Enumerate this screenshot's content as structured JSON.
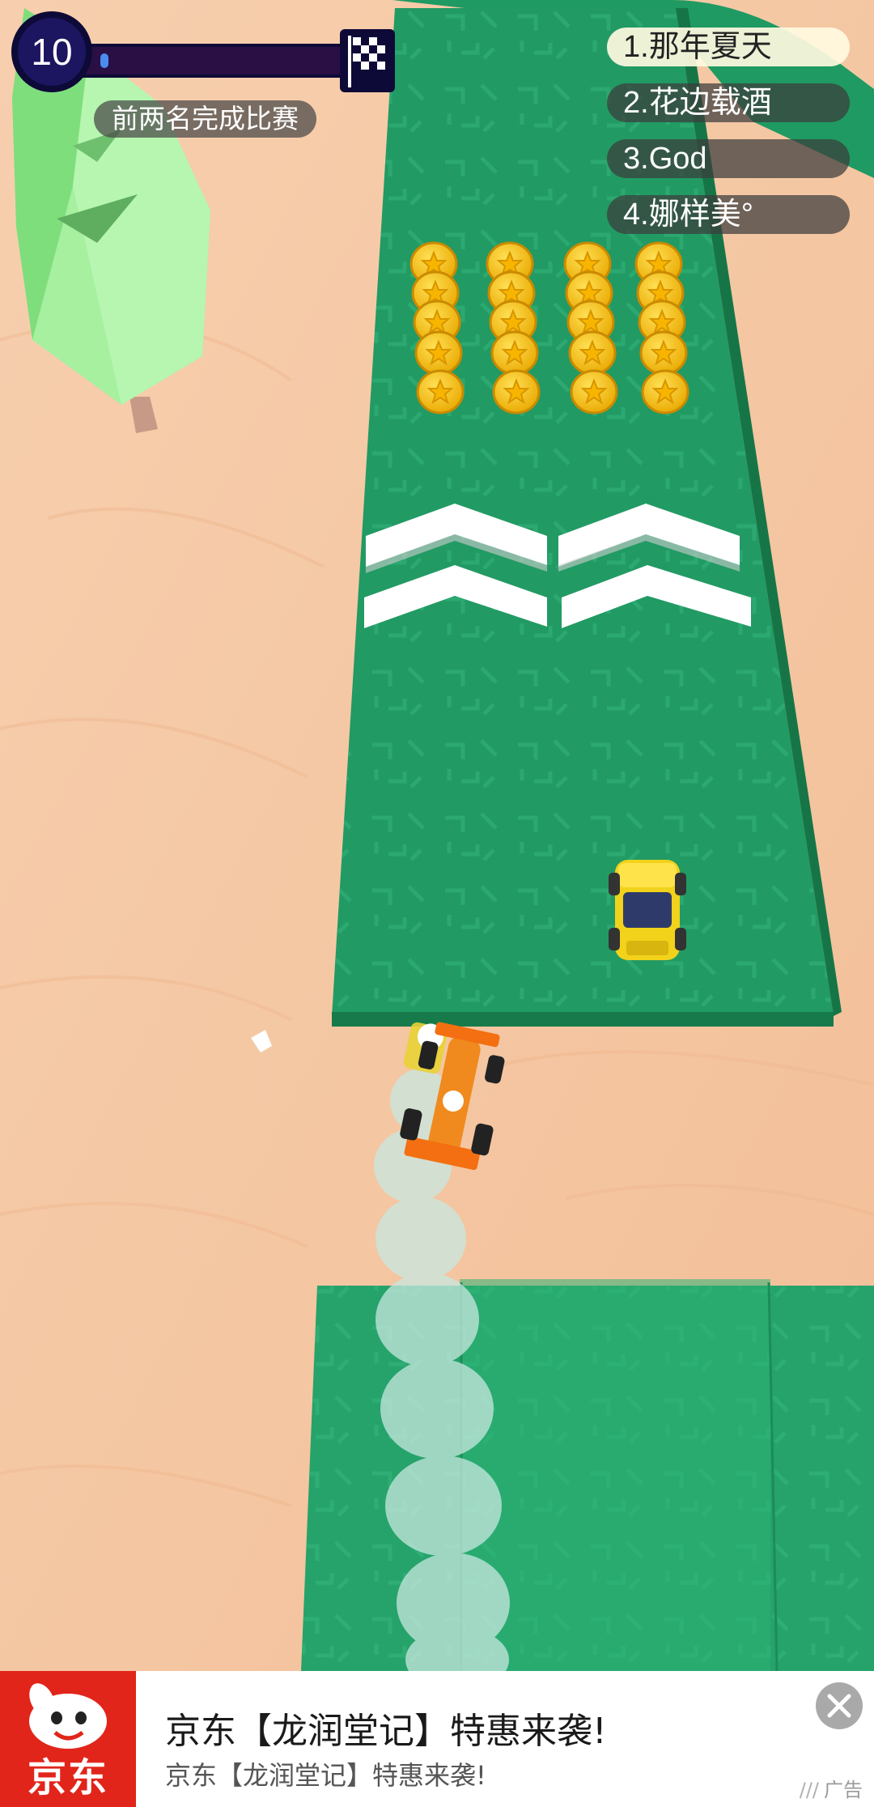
{
  "hud": {
    "level": "10",
    "progress": 0.02,
    "goal_text": "前两名完成比赛",
    "finish_icon": "checkered-flag-icon"
  },
  "ranking": [
    {
      "text": "1.那年夏天",
      "leader": true
    },
    {
      "text": "2.花边载酒",
      "leader": false
    },
    {
      "text": "3.God",
      "leader": false
    },
    {
      "text": "4.娜样美°",
      "leader": false
    }
  ],
  "ad": {
    "brand": "京东",
    "title": "京东【龙润堂记】特惠来袭!",
    "subtitle": "京东【龙润堂记】特惠来袭!",
    "tag": "广告",
    "close_icon": "close-icon"
  },
  "colors": {
    "sand": "#f5c9a6",
    "track": "#2aa36f",
    "coin": "#f5c316",
    "ad_brand": "#e1251b"
  }
}
